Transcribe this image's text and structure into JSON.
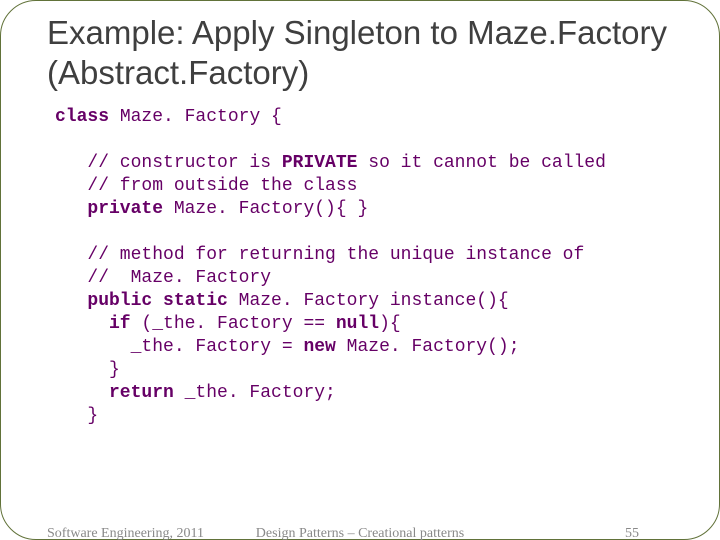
{
  "title": "Example: Apply Singleton to Maze.Factory (Abstract.Factory)",
  "code": {
    "l1a": "class",
    "l1b": " Maze. Factory {",
    "l3": "   // constructor is ",
    "l3b": "PRIVATE",
    "l3c": " so it cannot be called",
    "l4": "   // from outside the class",
    "l5a": "   private ",
    "l5b": "Maze. Factory(){ }",
    "l7": "   // method for returning the unique instance of",
    "l8": "   //  Maze. Factory",
    "l9a": "   public static ",
    "l9b": "Maze. Factory instance(){",
    "l10a": "     if ",
    "l10b": "(_the. Factory == ",
    "l10c": "null",
    "l10d": "){",
    "l11a": "       _the. Factory = ",
    "l11b": "new ",
    "l11c": "Maze. Factory();",
    "l12": "     }",
    "l13a": "     return ",
    "l13b": "_the. Factory;",
    "l14": "   }"
  },
  "footer": {
    "left": "Software Engineering, 2011",
    "center": "Design Patterns – Creational patterns",
    "right": "55"
  }
}
